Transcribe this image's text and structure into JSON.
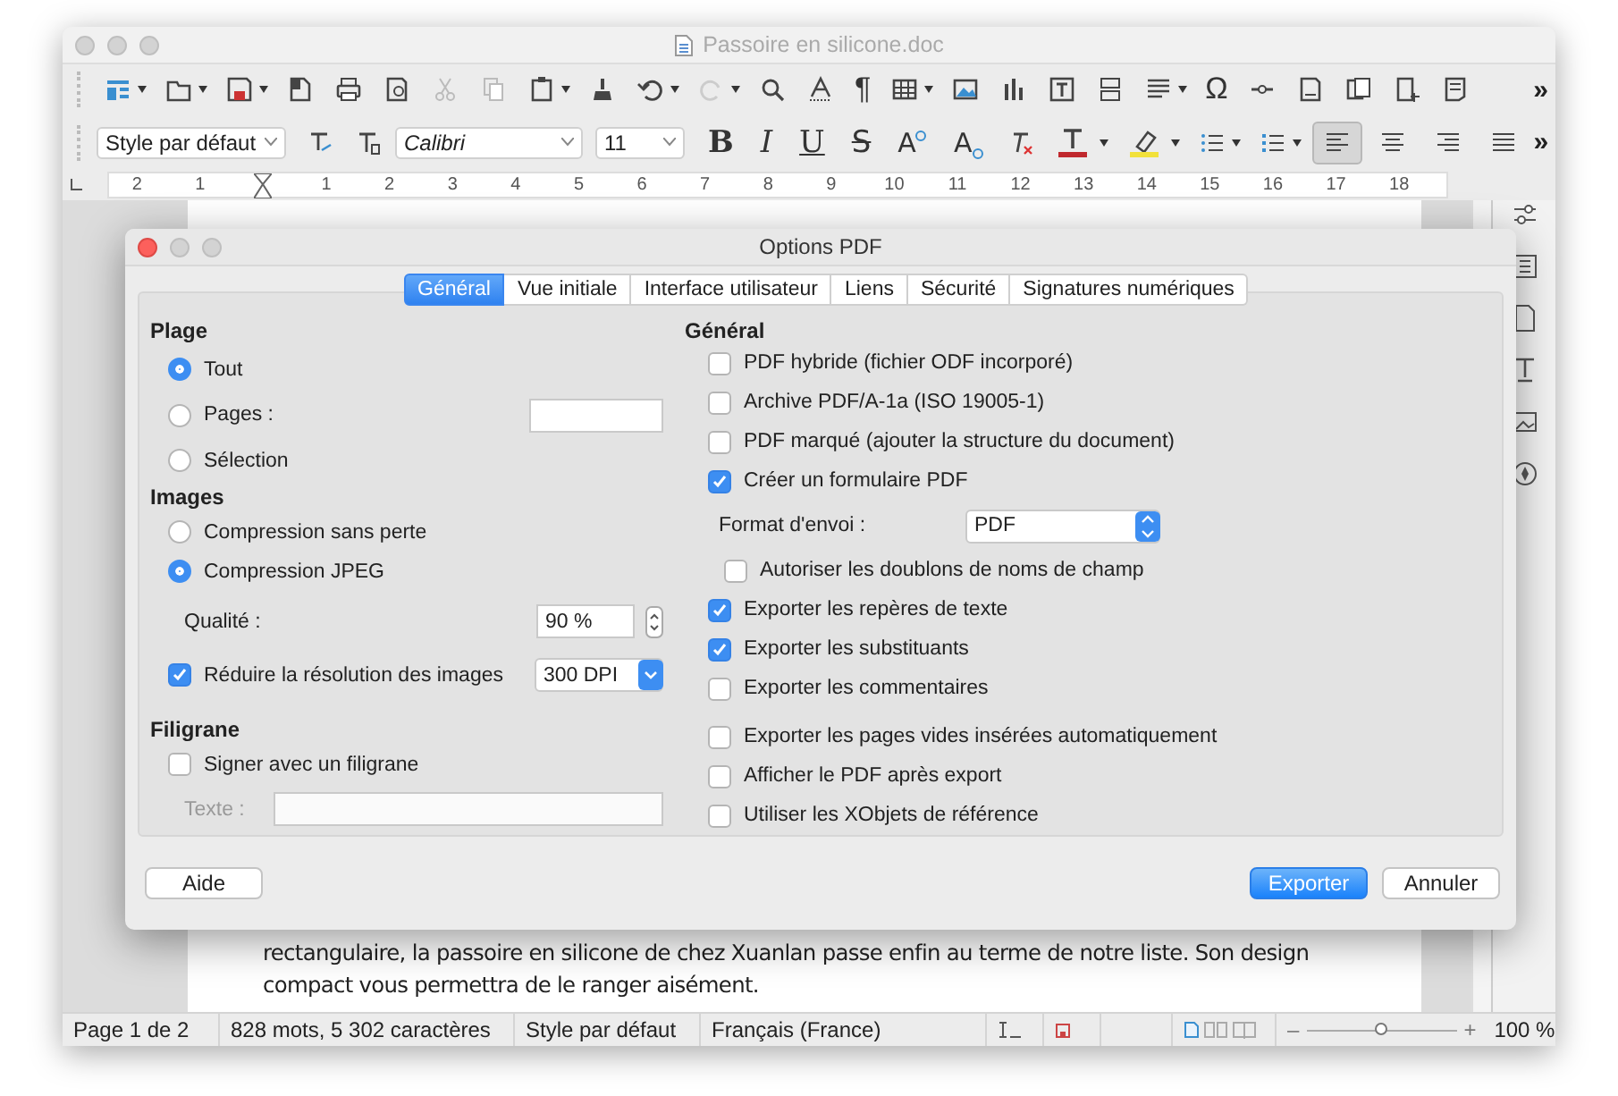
{
  "window": {
    "title": "Passoire en silicone.doc"
  },
  "standard_toolbar": {
    "pilcrow": "¶",
    "omega": "Ω",
    "more": "»"
  },
  "formatting_toolbar": {
    "style": "Style par défaut",
    "font": "Calibri",
    "size": "11",
    "text_buttons": [
      {
        "label": "B",
        "kind": "bold"
      },
      {
        "label": "I",
        "kind": "italic"
      },
      {
        "label": "U",
        "kind": "underline"
      },
      {
        "label": "S",
        "kind": "strike"
      },
      {
        "label": "A",
        "kind": "superscript"
      },
      {
        "label": "A",
        "kind": "subscript"
      }
    ],
    "alignment": [
      {
        "selected": true
      },
      {
        "selected": false
      },
      {
        "selected": false
      },
      {
        "selected": false
      }
    ],
    "more": "»"
  },
  "ruler": {
    "labels": [
      "2",
      "1",
      "1",
      "2",
      "3",
      "4",
      "5",
      "6",
      "7",
      "8",
      "9",
      "10",
      "11",
      "12",
      "13",
      "14",
      "15",
      "16",
      "17",
      "18"
    ]
  },
  "document": {
    "paragraph": "rectangulaire, la passoire en silicone de chez Xuanlan passe enfin au terme de notre liste. Son design compact vous permettra de le ranger aisément."
  },
  "dialog": {
    "title": "Options PDF",
    "tabs": [
      {
        "label": "Général",
        "selected": true
      },
      {
        "label": "Vue initiale",
        "selected": false
      },
      {
        "label": "Interface utilisateur",
        "selected": false
      },
      {
        "label": "Liens",
        "selected": false
      },
      {
        "label": "Sécurité",
        "selected": false
      },
      {
        "label": "Signatures numériques",
        "selected": false
      }
    ],
    "range": {
      "heading": "Plage",
      "options": [
        {
          "label": "Tout",
          "selected": true
        },
        {
          "label": "Pages :",
          "selected": false
        },
        {
          "label": "Sélection",
          "selected": false
        }
      ]
    },
    "images": {
      "heading": "Images",
      "options": [
        {
          "label": "Compression sans perte",
          "selected": false
        },
        {
          "label": "Compression JPEG",
          "selected": true
        }
      ],
      "quality_label": "Qualité :",
      "quality": "90 %",
      "reduce": {
        "label": "Réduire la résolution des images",
        "checked": true
      },
      "resolution": "300 DPI"
    },
    "watermark": {
      "heading": "Filigrane",
      "sign": {
        "label": "Signer avec un filigrane",
        "checked": false
      },
      "text_label": "Texte :",
      "text_disabled": true
    },
    "general": {
      "heading": "Général",
      "groups": [
        [
          {
            "kind": "checkbox",
            "label": "PDF hybride (fichier ODF incorporé)",
            "checked": false
          },
          {
            "kind": "checkbox",
            "label": "Archive PDF/A-1a (ISO 19005-1)",
            "checked": false
          },
          {
            "kind": "checkbox",
            "label": "PDF marqué (ajouter la structure du document)",
            "checked": false
          },
          {
            "kind": "checkbox",
            "label": "Créer un formulaire PDF",
            "checked": true,
            "children": [
              {
                "kind": "select",
                "label": "Format d'envoi :",
                "value": "PDF"
              },
              {
                "kind": "checkbox",
                "label": "Autoriser les doublons de noms de champ",
                "checked": false
              }
            ]
          },
          {
            "kind": "checkbox",
            "label": "Exporter les repères de texte",
            "checked": true
          },
          {
            "kind": "checkbox",
            "label": "Exporter les substituants",
            "checked": true
          },
          {
            "kind": "checkbox",
            "label": "Exporter les commentaires",
            "checked": false
          }
        ],
        [
          {
            "kind": "checkbox",
            "label": "Exporter les pages vides insérées automatiquement",
            "checked": false
          },
          {
            "kind": "checkbox",
            "label": "Afficher le PDF après export",
            "checked": false
          },
          {
            "kind": "checkbox",
            "label": "Utiliser les XObjets de référence",
            "checked": false
          }
        ]
      ]
    },
    "buttons": [
      {
        "label": "Aide",
        "kind": "plain"
      },
      {
        "label": "Exporter",
        "kind": "default"
      },
      {
        "label": "Annuler",
        "kind": "plain"
      }
    ]
  },
  "status_bar": {
    "page": "Page 1 de 2",
    "words": "828 mots, 5 302 caractères",
    "style": "Style par défaut",
    "language": "Français (France)",
    "zoom_out": "–",
    "zoom": {
      "level": 0.5
    },
    "zoom_in": "+",
    "zoom_text": "100 %"
  }
}
